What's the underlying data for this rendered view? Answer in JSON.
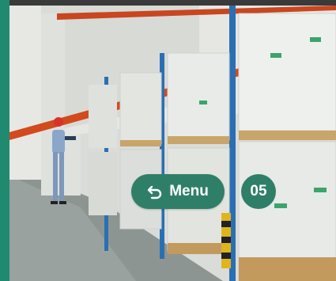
{
  "menu_button": {
    "label": "Menu",
    "icon": "undo-arrow-icon"
  },
  "page_badge": {
    "number": "05"
  },
  "colors": {
    "accent": "#1f8a70",
    "button": "#2f7f68",
    "rack_orange": "#d24a1e",
    "rack_blue": "#2b6fb3"
  },
  "background_image": {
    "subject": "warehouse-aisle-with-pallet-racks-and-worker"
  }
}
